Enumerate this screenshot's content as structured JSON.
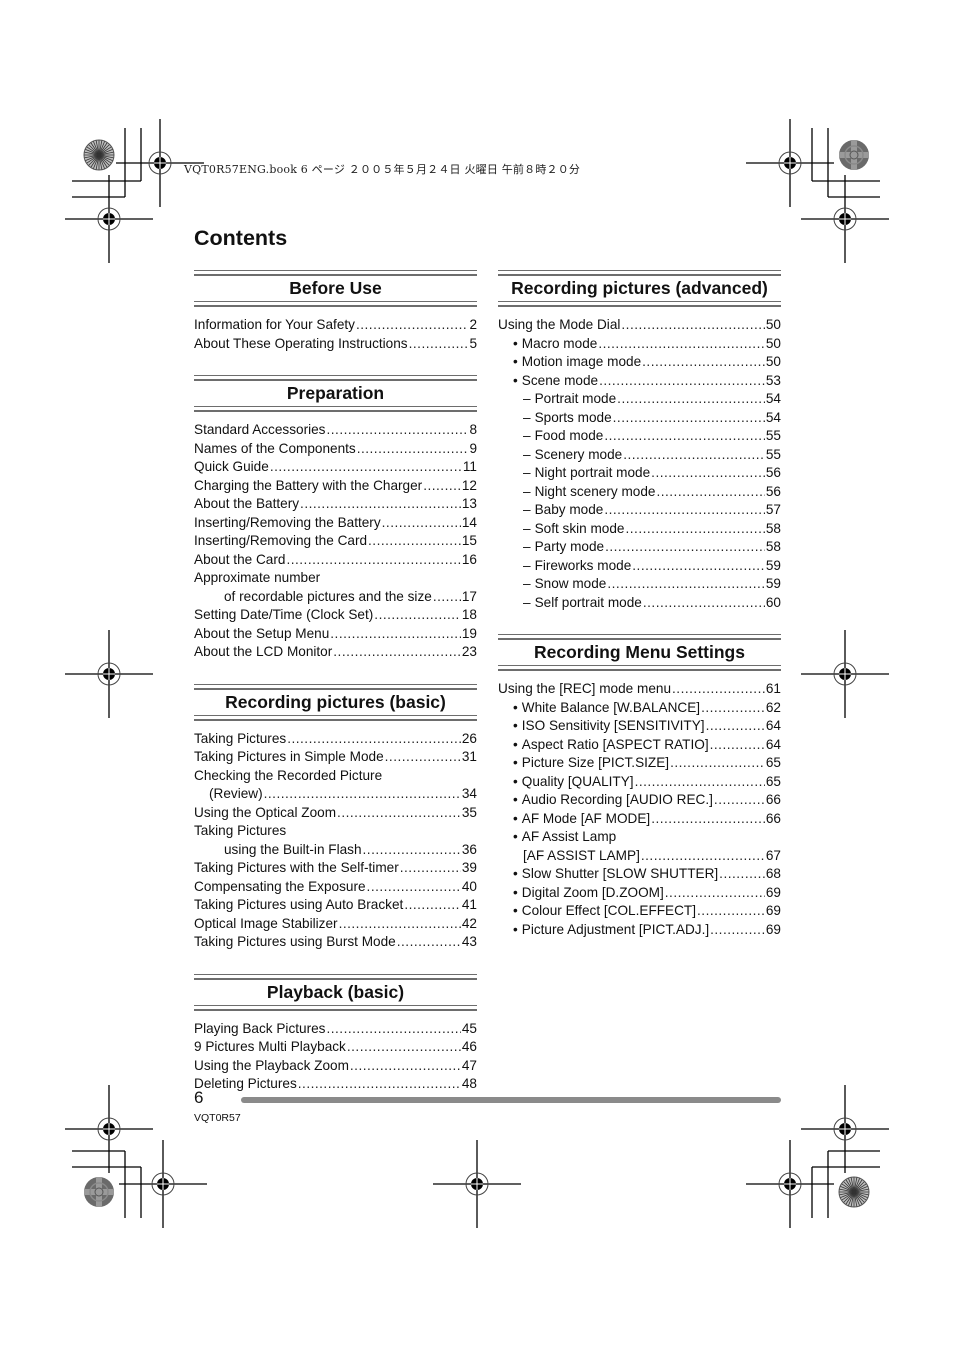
{
  "print_header": {
    "text": "VQT0R57ENG.book  6 ページ  ２００５年５月２４日  火曜日  午前８時２０分"
  },
  "page_title": "Contents",
  "left_column": [
    {
      "title": "Before Use",
      "entries": [
        {
          "label": "Information for Your Safety",
          "page": "2",
          "style": "top"
        },
        {
          "label": "About These Operating Instructions",
          "page": "5",
          "style": "top"
        }
      ]
    },
    {
      "title": "Preparation",
      "entries": [
        {
          "label": "Standard Accessories",
          "page": "8",
          "style": "top"
        },
        {
          "label": "Names of the Components",
          "page": "9",
          "style": "top"
        },
        {
          "label": "Quick Guide",
          "page": "11",
          "style": "top"
        },
        {
          "label": "Charging the Battery with the Charger",
          "page": "12",
          "style": "top"
        },
        {
          "label": "About the Battery",
          "page": "13",
          "style": "top"
        },
        {
          "label": "Inserting/Removing the Battery",
          "page": "14",
          "style": "top"
        },
        {
          "label": "Inserting/Removing the Card",
          "page": "15",
          "style": "top"
        },
        {
          "label": "About the Card",
          "page": "16",
          "style": "top"
        },
        {
          "label": "Approximate number",
          "page": "",
          "style": "plain"
        },
        {
          "label": "of recordable pictures and the size",
          "page": "17",
          "style": "cont"
        },
        {
          "label": "Setting Date/Time (Clock Set)",
          "page": "18",
          "style": "top"
        },
        {
          "label": "About the Setup Menu",
          "page": "19",
          "style": "top"
        },
        {
          "label": "About the LCD Monitor",
          "page": "23",
          "style": "top"
        }
      ]
    },
    {
      "title": "Recording pictures (basic)",
      "entries": [
        {
          "label": "Taking Pictures",
          "page": "26",
          "style": "top"
        },
        {
          "label": "Taking Pictures in Simple Mode",
          "page": "31",
          "style": "top"
        },
        {
          "label": "Checking the Recorded Picture",
          "page": "",
          "style": "plain"
        },
        {
          "label": "(Review)",
          "page": "34",
          "style": "cont-short"
        },
        {
          "label": "Using the Optical Zoom",
          "page": "35",
          "style": "top"
        },
        {
          "label": "Taking Pictures",
          "page": "",
          "style": "plain"
        },
        {
          "label": "using the Built-in Flash",
          "page": "36",
          "style": "cont"
        },
        {
          "label": "Taking Pictures with the Self-timer",
          "page": "39",
          "style": "top"
        },
        {
          "label": "Compensating the Exposure",
          "page": "40",
          "style": "top"
        },
        {
          "label": "Taking Pictures using Auto Bracket",
          "page": "41",
          "style": "top"
        },
        {
          "label": "Optical Image Stabilizer",
          "page": "42",
          "style": "top"
        },
        {
          "label": "Taking Pictures using Burst Mode",
          "page": "43",
          "style": "top"
        }
      ]
    },
    {
      "title": "Playback (basic)",
      "entries": [
        {
          "label": "Playing Back Pictures",
          "page": "45",
          "style": "top"
        },
        {
          "label": "9 Pictures Multi Playback",
          "page": "46",
          "style": "top"
        },
        {
          "label": "Using the Playback Zoom",
          "page": "47",
          "style": "top"
        },
        {
          "label": "Deleting Pictures",
          "page": "48",
          "style": "top"
        }
      ]
    }
  ],
  "right_column": [
    {
      "title": "Recording pictures (advanced)",
      "entries": [
        {
          "label": "Using the Mode Dial",
          "page": "50",
          "style": "top"
        },
        {
          "label": "Macro mode",
          "page": "50",
          "style": "bullet"
        },
        {
          "label": "Motion image mode",
          "page": "50",
          "style": "bullet"
        },
        {
          "label": "Scene mode",
          "page": "53",
          "style": "bullet"
        },
        {
          "label": "Portrait mode",
          "page": "54",
          "style": "dash"
        },
        {
          "label": "Sports mode",
          "page": "54",
          "style": "dash"
        },
        {
          "label": "Food mode",
          "page": "55",
          "style": "dash"
        },
        {
          "label": "Scenery mode",
          "page": "55",
          "style": "dash"
        },
        {
          "label": "Night portrait mode",
          "page": "56",
          "style": "dash"
        },
        {
          "label": "Night scenery mode",
          "page": "56",
          "style": "dash"
        },
        {
          "label": "Baby mode",
          "page": "57",
          "style": "dash"
        },
        {
          "label": "Soft skin mode",
          "page": "58",
          "style": "dash"
        },
        {
          "label": "Party mode",
          "page": "58",
          "style": "dash"
        },
        {
          "label": "Fireworks mode",
          "page": "59",
          "style": "dash"
        },
        {
          "label": "Snow mode",
          "page": "59",
          "style": "dash"
        },
        {
          "label": "Self portrait mode",
          "page": "60",
          "style": "dash"
        }
      ]
    },
    {
      "title": "Recording Menu Settings",
      "entries": [
        {
          "label": "Using the [REC] mode menu",
          "page": "61",
          "style": "top"
        },
        {
          "label": "White Balance [W.BALANCE]",
          "page": "62",
          "style": "bullet"
        },
        {
          "label": "ISO Sensitivity [SENSITIVITY]",
          "page": "64",
          "style": "bullet"
        },
        {
          "label": "Aspect Ratio [ASPECT RATIO]",
          "page": "64",
          "style": "bullet"
        },
        {
          "label": "Picture Size [PICT.SIZE]",
          "page": "65",
          "style": "bullet"
        },
        {
          "label": "Quality [QUALITY]",
          "page": "65",
          "style": "bullet"
        },
        {
          "label": "Audio Recording [AUDIO REC.]",
          "page": "66",
          "style": "bullet"
        },
        {
          "label": "AF Mode [AF MODE]",
          "page": "66",
          "style": "bullet"
        },
        {
          "label": "AF Assist Lamp",
          "page": "",
          "style": "bullet-plain"
        },
        {
          "label": "[AF ASSIST LAMP]",
          "page": "67",
          "style": "bullet-cont"
        },
        {
          "label": "Slow Shutter [SLOW SHUTTER]",
          "page": "68",
          "style": "bullet"
        },
        {
          "label": "Digital Zoom [D.ZOOM]",
          "page": "69",
          "style": "bullet"
        },
        {
          "label": "Colour Effect [COL.EFFECT]",
          "page": "69",
          "style": "bullet"
        },
        {
          "label": "Picture Adjustment [PICT.ADJ.]",
          "page": "69",
          "style": "bullet"
        }
      ]
    }
  ],
  "symbols": {
    "bullet": "•",
    "dash": "–"
  },
  "footer": {
    "page_number": "6",
    "model_code": "VQT0R57"
  }
}
